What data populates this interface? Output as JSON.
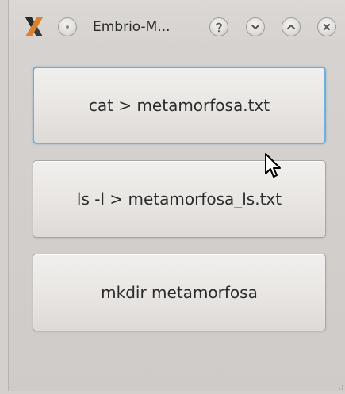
{
  "window": {
    "title": "Embrio-M...",
    "app_icon": "x-app-icon"
  },
  "titlebar_buttons": [
    {
      "name": "menu-button",
      "icon": "dot-icon"
    },
    {
      "name": "help-button",
      "icon": "question-icon"
    },
    {
      "name": "minimize-button",
      "icon": "chevron-down-icon"
    },
    {
      "name": "maximize-button",
      "icon": "chevron-up-icon"
    },
    {
      "name": "close-button",
      "icon": "close-icon"
    }
  ],
  "buttons": [
    {
      "label": "cat > metamorfosa.txt",
      "focused": true
    },
    {
      "label": "ls -l > metamorfosa_ls.txt",
      "focused": false
    },
    {
      "label": "mkdir metamorfosa",
      "focused": false
    }
  ],
  "colors": {
    "focus_ring": "#6eb0d8",
    "window_bg": "#d6d2cf",
    "button_text": "#2b2b2b"
  }
}
